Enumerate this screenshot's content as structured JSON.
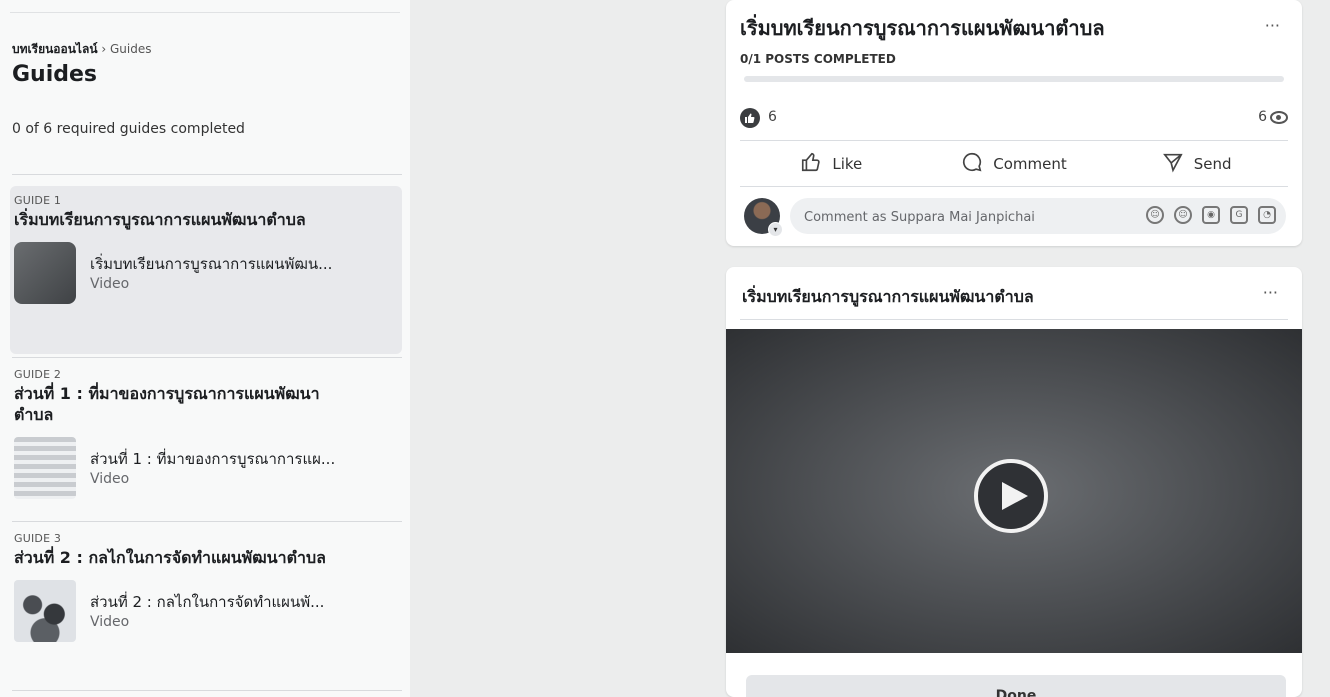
{
  "sidebar": {
    "breadcrumb_root": "บทเรียนออนไลน์",
    "breadcrumb_sep": "›",
    "breadcrumb_current": "Guides",
    "title": "Guides",
    "progress": "0 of 6 required guides completed",
    "guides": [
      {
        "label": "GUIDE 1",
        "title": "เริ่มบทเรียนการบูรณาการแผนพัฒนาตำบล",
        "item_title": "เริ่มบทเรียนการบูรณาการแผนพัฒน...",
        "item_type": "Video"
      },
      {
        "label": "GUIDE 2",
        "title": "ส่วนที่ 1 : ที่มาของการบูรณาการแผนพัฒนาตำบล",
        "item_title": "ส่วนที่ 1 : ที่มาของการบูรณาการแผ...",
        "item_type": "Video"
      },
      {
        "label": "GUIDE 3",
        "title": "ส่วนที่ 2 : กลไกในการจัดทำแผนพัฒนาตำบล",
        "item_title": "ส่วนที่ 2 : กลไกในการจัดทำแผนพั...",
        "item_type": "Video"
      }
    ]
  },
  "post": {
    "title": "เริ่มบทเรียนการบูรณาการแผนพัฒนาตำบล",
    "more": "···",
    "completed": "0/1 POSTS COMPLETED",
    "progress_fraction": 0,
    "like_count": "6",
    "view_count": "6",
    "actions": {
      "like": "Like",
      "comment": "Comment",
      "send": "Send"
    },
    "comment_placeholder": "Comment as Suppara Mai Janpichai"
  },
  "video_post": {
    "title": "เริ่มบทเรียนการบูรณาการแผนพัฒนาตำบล",
    "more": "···",
    "done_label": "Done"
  },
  "colors": {
    "accent": "#1b74e4",
    "sidebar_bg": "#f8f9f9",
    "page_bg": "#eceded"
  }
}
